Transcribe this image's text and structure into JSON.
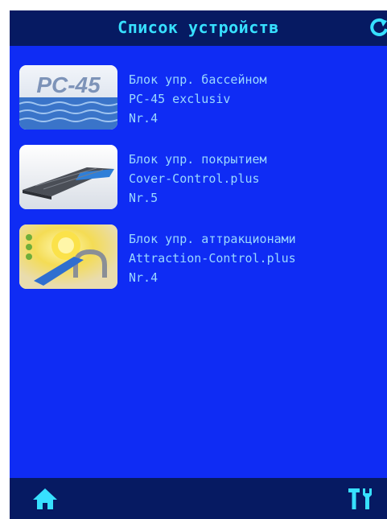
{
  "header": {
    "title": "Список устройств",
    "refresh_icon": "refresh-icon"
  },
  "devices": [
    {
      "line1": "Блок упр. бассейном",
      "line2": "PC-45 exclusiv",
      "line3": "Nr.4",
      "thumb_icon": "pool-controller-thumbnail",
      "thumb_label": "PC-45"
    },
    {
      "line1": "Блок упр. покрытием",
      "line2": "Cover-Control.plus",
      "line3": "Nr.5",
      "thumb_icon": "pool-cover-thumbnail"
    },
    {
      "line1": "Блок упр. аттракционами",
      "line2": "Attraction-Control.plus",
      "line3": "Nr.4",
      "thumb_icon": "attraction-thumbnail"
    }
  ],
  "footer": {
    "home_icon": "home-icon",
    "settings_icon": "tools-icon"
  },
  "colors": {
    "background": "#0f2cf4",
    "bars": "#061a62",
    "title_text": "#37e0ff",
    "item_text": "#9ad8ff"
  }
}
